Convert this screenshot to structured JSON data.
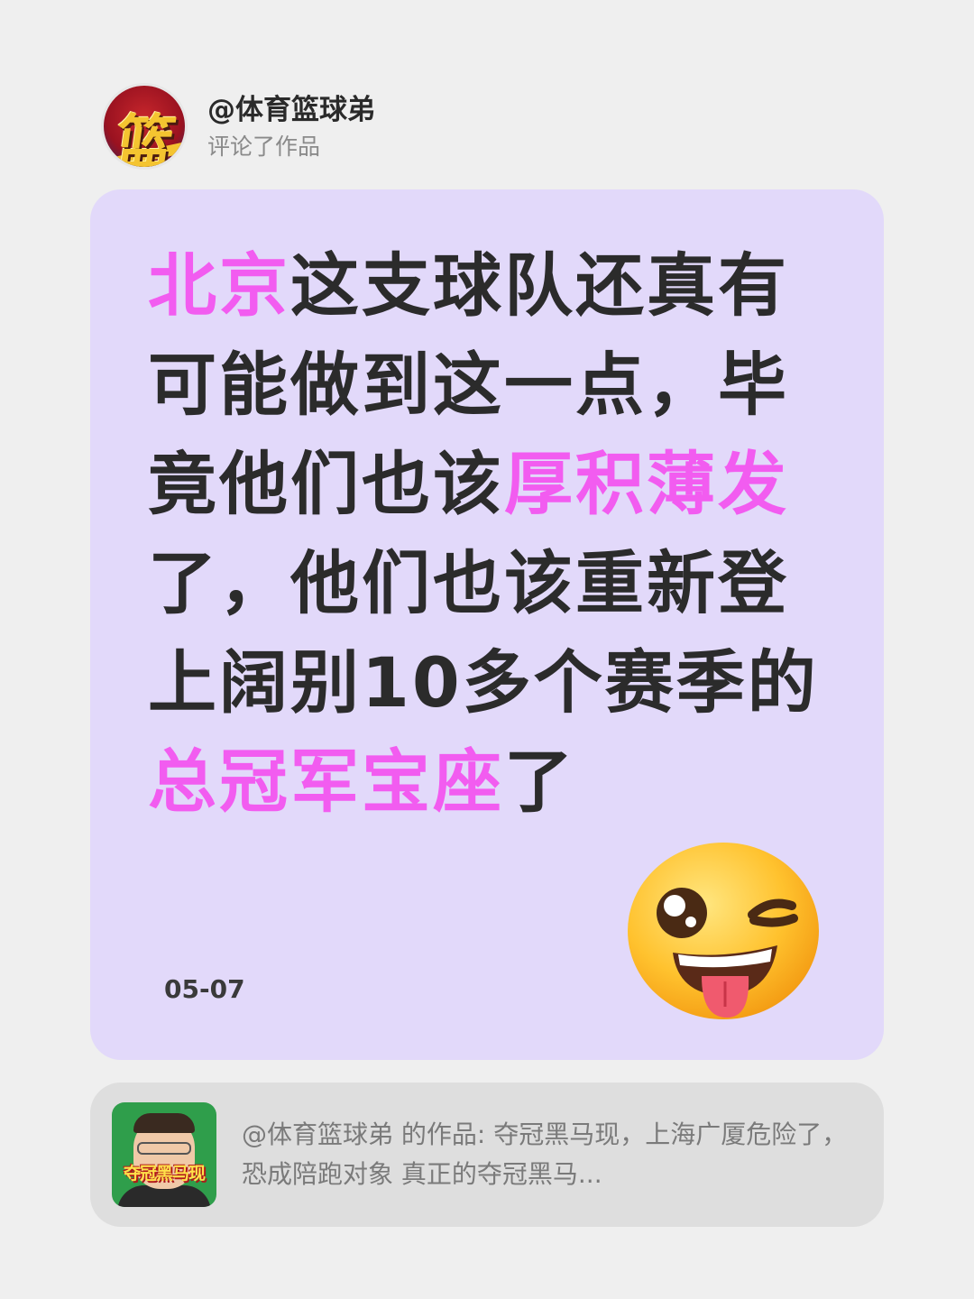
{
  "header": {
    "avatar_icon": "basketball-brand-logo-icon",
    "avatar_glyph": "篮",
    "username": "@体育篮球弟",
    "subtitle": "评论了作品"
  },
  "comment": {
    "segments": [
      {
        "text": "北京",
        "highlight": true
      },
      {
        "text": "这支球队还真有可能做到这一点，毕竟他们也该",
        "highlight": false
      },
      {
        "text": "厚积薄发",
        "highlight": true
      },
      {
        "text": "了，他们也该重新登上阔别10多个赛季的",
        "highlight": false
      },
      {
        "text": "总冠军宝座",
        "highlight": true
      },
      {
        "text": "了",
        "highlight": false
      }
    ],
    "date": "05-07",
    "emoji": "winking-face-with-tongue-icon",
    "colors": {
      "card_bg": "#e2d9fa",
      "text": "#2b2b2b",
      "highlight": "#f25cf0"
    }
  },
  "reference": {
    "thumbnail_caption": "夺冠黑马现",
    "thumbnail_icon": "video-thumbnail-man-portrait",
    "text": "@体育篮球弟 的作品: 夺冠黑马现，上海广厦危险了，恐成陪跑对象 真正的夺冠黑马..."
  }
}
